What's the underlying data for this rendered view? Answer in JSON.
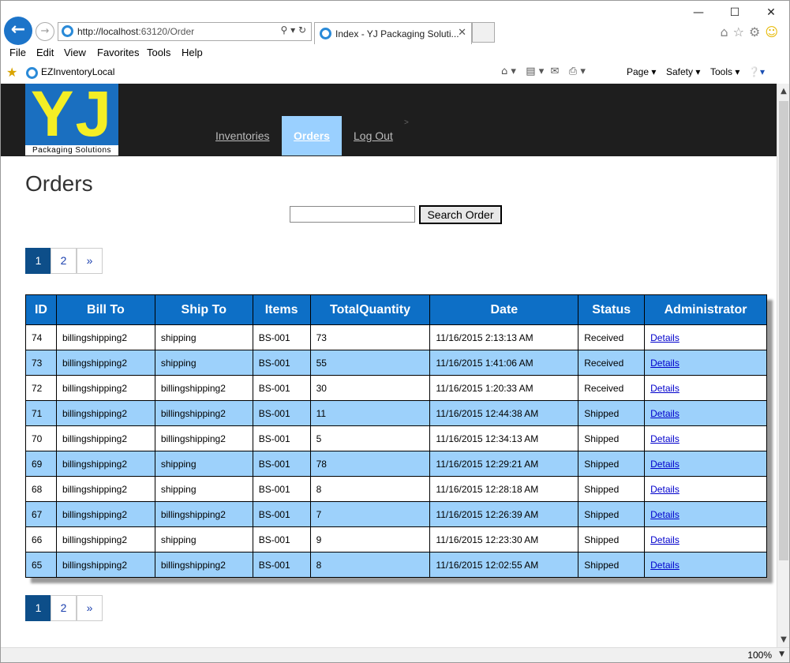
{
  "browser": {
    "address": {
      "prefix": "http://",
      "host": "localhost",
      "path": ":63120/Order"
    },
    "tab": {
      "title": "Index - YJ Packaging Soluti..."
    },
    "menu": [
      "File",
      "Edit",
      "View",
      "Favorites",
      "Tools",
      "Help"
    ],
    "favorites": {
      "link": "EZInventoryLocal"
    },
    "commands": [
      "Page ▾",
      "Safety ▾",
      "Tools ▾"
    ],
    "zoom": "100%"
  },
  "site": {
    "logo_mark": "YJ",
    "logo_caption": "Packaging Solutions",
    "nav": [
      "Inventories",
      "Orders",
      "Log Out"
    ]
  },
  "page": {
    "title": "Orders",
    "search": {
      "placeholder": "",
      "button": "Search Order"
    },
    "pager": [
      "1",
      "2",
      "»"
    ]
  },
  "table": {
    "columns": [
      "ID",
      "Bill To",
      "Ship To",
      "Items",
      "TotalQuantity",
      "Date",
      "Status",
      "Administrator"
    ],
    "rows": [
      [
        "74",
        "billingshipping2",
        "shipping",
        "BS-001",
        "73",
        "11/16/2015 2:13:13 AM",
        "Received",
        "Details"
      ],
      [
        "73",
        "billingshipping2",
        "shipping",
        "BS-001",
        "55",
        "11/16/2015 1:41:06 AM",
        "Received",
        "Details"
      ],
      [
        "72",
        "billingshipping2",
        "billingshipping2",
        "BS-001",
        "30",
        "11/16/2015 1:20:33 AM",
        "Received",
        "Details"
      ],
      [
        "71",
        "billingshipping2",
        "billingshipping2",
        "BS-001",
        "11",
        "11/16/2015 12:44:38 AM",
        "Shipped",
        "Details"
      ],
      [
        "70",
        "billingshipping2",
        "billingshipping2",
        "BS-001",
        "5",
        "11/16/2015 12:34:13 AM",
        "Shipped",
        "Details"
      ],
      [
        "69",
        "billingshipping2",
        "shipping",
        "BS-001",
        "78",
        "11/16/2015 12:29:21 AM",
        "Shipped",
        "Details"
      ],
      [
        "68",
        "billingshipping2",
        "shipping",
        "BS-001",
        "8",
        "11/16/2015 12:28:18 AM",
        "Shipped",
        "Details"
      ],
      [
        "67",
        "billingshipping2",
        "billingshipping2",
        "BS-001",
        "7",
        "11/16/2015 12:26:39 AM",
        "Shipped",
        "Details"
      ],
      [
        "66",
        "billingshipping2",
        "shipping",
        "BS-001",
        "9",
        "11/16/2015 12:23:30 AM",
        "Shipped",
        "Details"
      ],
      [
        "65",
        "billingshipping2",
        "billingshipping2",
        "BS-001",
        "8",
        "11/16/2015 12:02:55 AM",
        "Shipped",
        "Details"
      ]
    ]
  }
}
